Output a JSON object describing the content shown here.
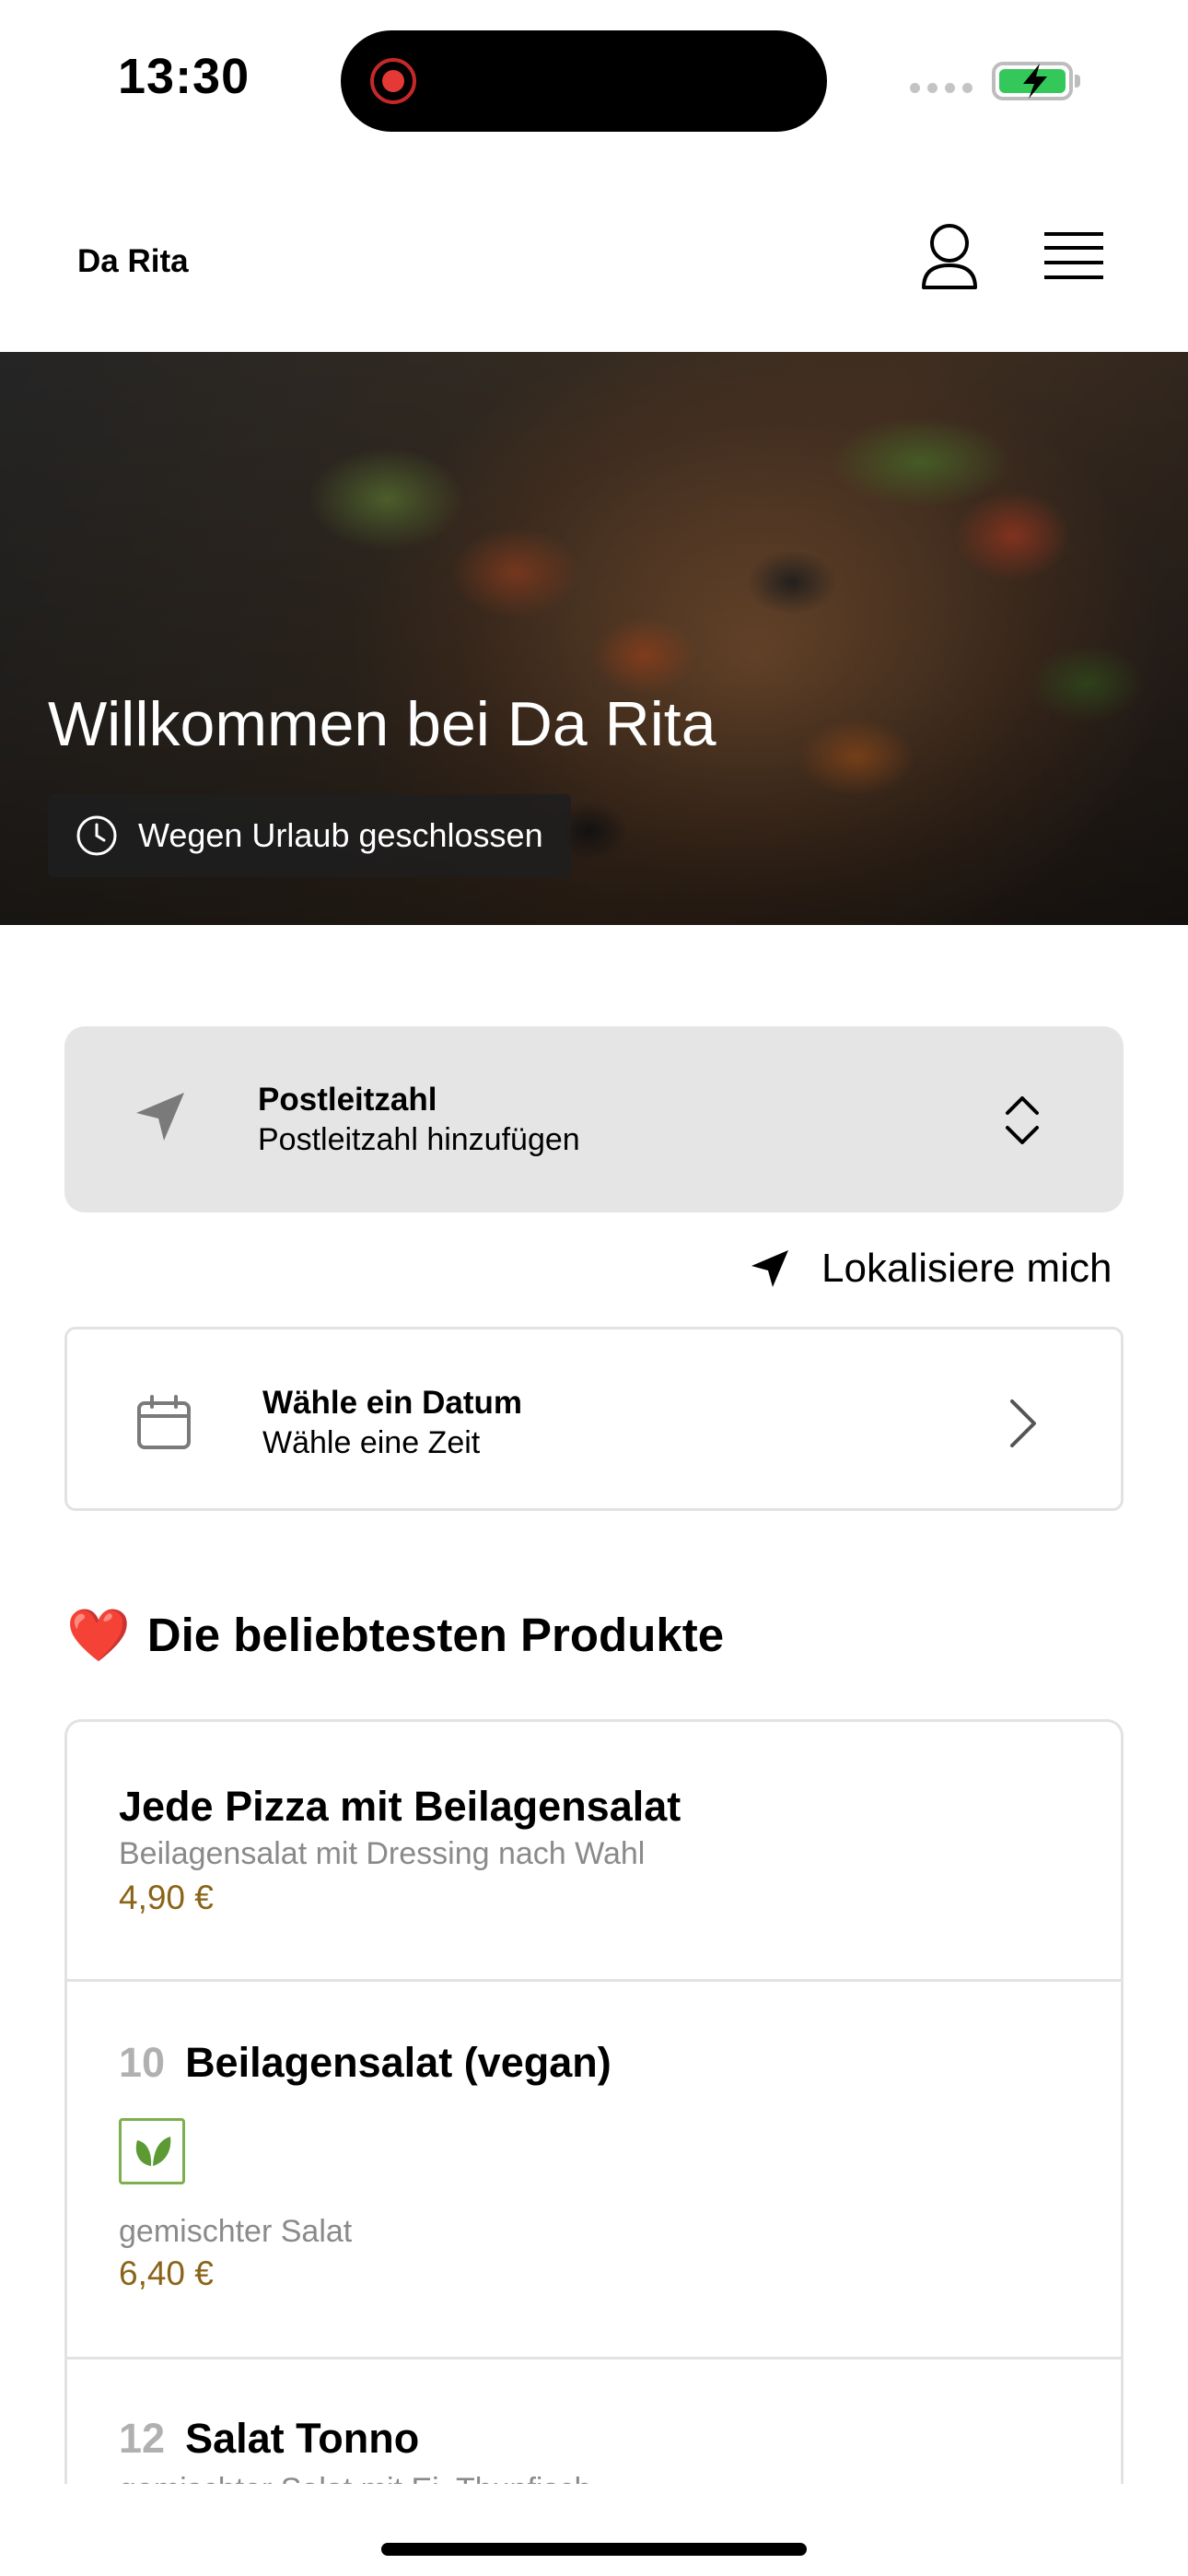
{
  "status_bar": {
    "time": "13:30"
  },
  "header": {
    "brand": "Da Rita",
    "icons": [
      "user-icon",
      "menu-icon"
    ]
  },
  "hero": {
    "title": "Willkommen bei Da Rita",
    "status_badge": "Wegen Urlaub geschlossen"
  },
  "zip": {
    "title": "Postleitzahl",
    "placeholder": "Postleitzahl hinzufügen"
  },
  "locate": {
    "label": "Lokalisiere mich"
  },
  "date": {
    "title": "Wähle ein Datum",
    "subtitle": "Wähle eine Zeit"
  },
  "popular": {
    "heading": "Die beliebtesten Produkte",
    "emoji": "❤️",
    "products": [
      {
        "number": "",
        "name": "Jede Pizza mit Beilagensalat",
        "description": "Beilagensalat mit Dressing nach Wahl",
        "price": "4,90 €"
      },
      {
        "number": "10",
        "name": "Beilagensalat (vegan)",
        "badge_icon": "vegan-leaf-icon",
        "description": "gemischter Salat",
        "price": "6,40 €"
      },
      {
        "number": "12",
        "name": "Salat Tonno",
        "description": "gemischter Salat mit Ei, Thunfisch"
      }
    ]
  },
  "colors": {
    "price": "#8a6418",
    "card_bg": "#e5e5e5",
    "vegan_green": "#7bb04c",
    "heart": "#e0242e"
  }
}
